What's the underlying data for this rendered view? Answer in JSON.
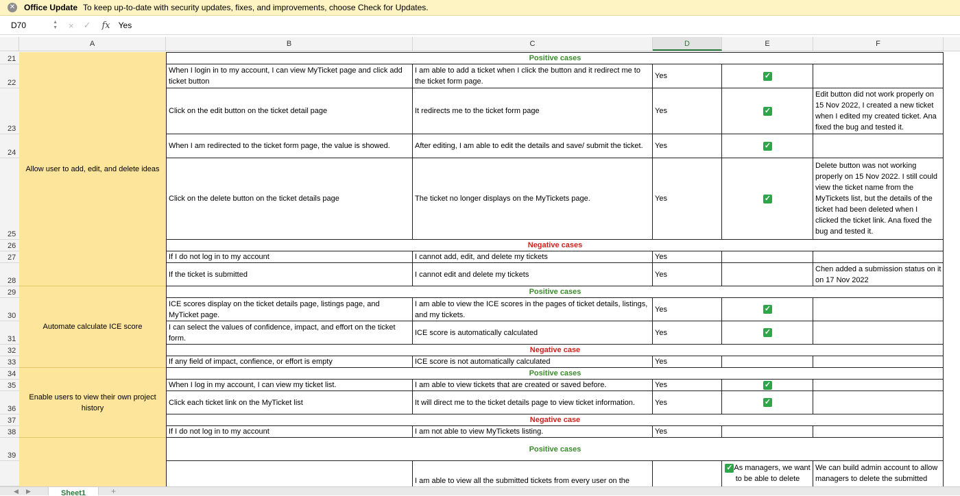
{
  "notification": {
    "title": "Office Update",
    "message": "To keep up-to-date with security updates, fixes, and improvements, choose Check for Updates."
  },
  "formula_bar": {
    "cell_ref": "D70",
    "cancel_icon": "×",
    "enter_icon": "✓",
    "fx_label": "fx",
    "value": "Yes"
  },
  "columns": [
    "A",
    "B",
    "C",
    "D",
    "E",
    "F"
  ],
  "selected_column": "D",
  "rows": [
    "21",
    "22",
    "23",
    "24",
    "25",
    "26",
    "27",
    "28",
    "29",
    "30",
    "31",
    "32",
    "33",
    "34",
    "35",
    "36",
    "37",
    "38",
    "39"
  ],
  "features": [
    "Allow user to add, edit, and delete ideas",
    "Automate calculate ICE score",
    "Enable users to view their own project history"
  ],
  "sections": {
    "pos1": "Positive cases",
    "neg1": "Negative cases",
    "pos2": "Positive cases",
    "neg2": "Negative case",
    "pos3": "Positive cases",
    "neg3": "Negative case",
    "pos4": "Positive cases"
  },
  "cells": {
    "b22": "When I login in to my account, I can view MyTicket page and click add ticket button",
    "c22": "I am able to add a ticket when I click the button and it redirect me to the ticket form page.",
    "d22": "Yes",
    "b23": "Click on the edit button on the ticket detail page",
    "c23": "It redirects me to the ticket form page",
    "d23": "Yes",
    "f23": "Edit button did not work properly on 15 Nov 2022, I created a new ticket when I edited my created ticket. Ana fixed the bug and tested it.",
    "b24": "When I am redirected to the ticket form page, the value is showed.",
    "c24": "After editing, I am  able to edit the details and save/ submit the ticket.",
    "d24": "Yes",
    "b25": "Click on the delete button on the ticket details page",
    "c25": "The ticket no longer displays on the MyTickets page.",
    "d25": "Yes",
    "f25": "Delete button was not working properly on 15 Nov 2022. I still could view the ticket name from the MyTickets list, but the details of the ticket had been deleted when I clicked the ticket link. Ana fixed the bug and tested it.",
    "b27": "If I do not log in to my account",
    "c27": "I cannot add, edit, and delete my tickets",
    "d27": "Yes",
    "b28": "If the ticket is submitted",
    "c28": "I cannot edit and delete my tickets",
    "d28": "Yes",
    "f28": "Chen added a submission status on it on 17 Nov 2022",
    "b30": "ICE scores display on the ticket details page, listings page, and MyTicket page.",
    "c30": "I am able to view the ICE scores in the pages of ticket details, listings, and my tickets.",
    "d30": "Yes",
    "b31": "I can select the values of confidence, impact, and effort on the ticket form.",
    "c31": "ICE score is automatically calculated",
    "d31": "Yes",
    "b33": " If any field of impact, confience, or effort  is empty",
    "c33": "ICE score is not automatically calculated",
    "d33": "Yes",
    "b35": "When I log in my account, I can view my ticket list.",
    "c35": "I am able to view tickets that are created or saved before.",
    "d35": "Yes",
    "b36": "Click each ticket link on the MyTicket list",
    "c36": "It will direct me to the ticket details page to view ticket information.",
    "d36": "Yes",
    "b38": "If I do not log in to my account",
    "c38": "I am not able to view MyTickets listing.",
    "d38": "Yes",
    "c40": "I am able to view all the submitted tickets from every user on the",
    "e40": "As managers, we want to be able to delete",
    "f40": "We can build admin account to allow managers to delete the submitted"
  },
  "check_mark": "✓",
  "colors": {
    "accent": "#2c7a3d",
    "feature_fill": "#fde59c",
    "positive": "#3c8a2e",
    "negative": "#d0201c",
    "check": "#2fa54b"
  },
  "sheet_tab": {
    "label": "Sheet1",
    "add": "+"
  }
}
